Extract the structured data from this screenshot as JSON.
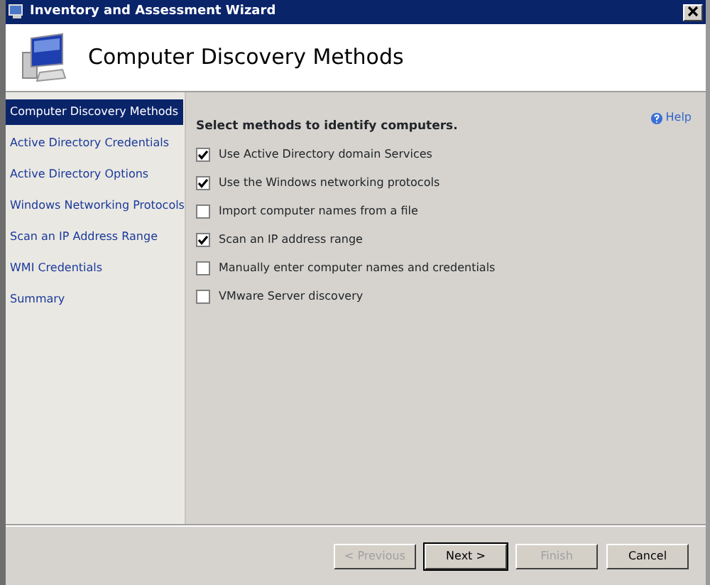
{
  "window": {
    "title": "Inventory and Assessment Wizard"
  },
  "header": {
    "title": "Computer Discovery Methods"
  },
  "sidebar": {
    "items": [
      {
        "label": "Computer Discovery Methods",
        "selected": true
      },
      {
        "label": "Active Directory Credentials",
        "selected": false
      },
      {
        "label": "Active Directory Options",
        "selected": false
      },
      {
        "label": "Windows Networking Protocols",
        "selected": false
      },
      {
        "label": "Scan an IP Address Range",
        "selected": false
      },
      {
        "label": "WMI Credentials",
        "selected": false
      },
      {
        "label": "Summary",
        "selected": false
      }
    ]
  },
  "help": {
    "label": "Help"
  },
  "content": {
    "heading": "Select methods to identify computers.",
    "options": [
      {
        "label": "Use Active Directory domain Services",
        "checked": true
      },
      {
        "label": "Use the Windows networking protocols",
        "checked": true
      },
      {
        "label": "Import computer names from a file",
        "checked": false
      },
      {
        "label": "Scan an IP address range",
        "checked": true
      },
      {
        "label": "Manually enter computer names and credentials",
        "checked": false
      },
      {
        "label": "VMware Server discovery",
        "checked": false
      }
    ]
  },
  "buttons": [
    {
      "label": "< Previous",
      "disabled": true
    },
    {
      "label": "Next >",
      "disabled": false
    },
    {
      "label": "Finish",
      "disabled": true
    },
    {
      "label": "Cancel",
      "disabled": false
    }
  ]
}
